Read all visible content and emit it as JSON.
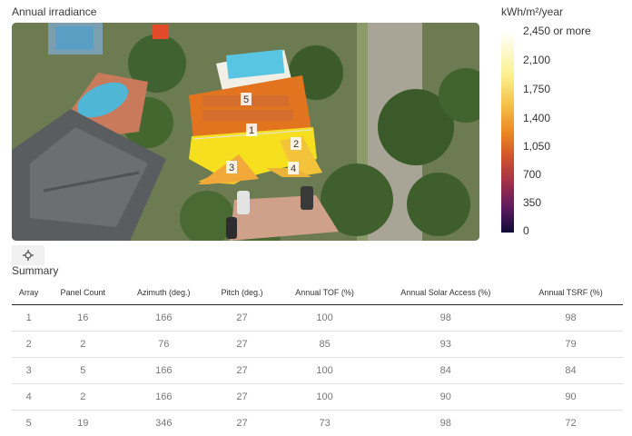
{
  "irradiance": {
    "title": "Annual irradiance"
  },
  "legend": {
    "unit": "kWh/m²/year",
    "ticks": [
      "2,450 or more",
      "2,100",
      "1,750",
      "1,400",
      "1,050",
      "700",
      "350",
      "0"
    ]
  },
  "map": {
    "array_labels": [
      "1",
      "2",
      "3",
      "4",
      "5"
    ]
  },
  "summary": {
    "title": "Summary",
    "columns": [
      "Array",
      "Panel Count",
      "Azimuth (deg.)",
      "Pitch (deg.)",
      "Annual TOF (%)",
      "Annual Solar Access (%)",
      "Annual TSRF (%)"
    ],
    "rows": [
      [
        "1",
        "16",
        "166",
        "27",
        "100",
        "98",
        "98"
      ],
      [
        "2",
        "2",
        "76",
        "27",
        "85",
        "93",
        "79"
      ],
      [
        "3",
        "5",
        "166",
        "27",
        "100",
        "84",
        "84"
      ],
      [
        "4",
        "2",
        "166",
        "27",
        "100",
        "90",
        "90"
      ],
      [
        "5",
        "19",
        "346",
        "27",
        "73",
        "98",
        "72"
      ]
    ]
  },
  "icons": {
    "locate": "crosshair-icon"
  }
}
